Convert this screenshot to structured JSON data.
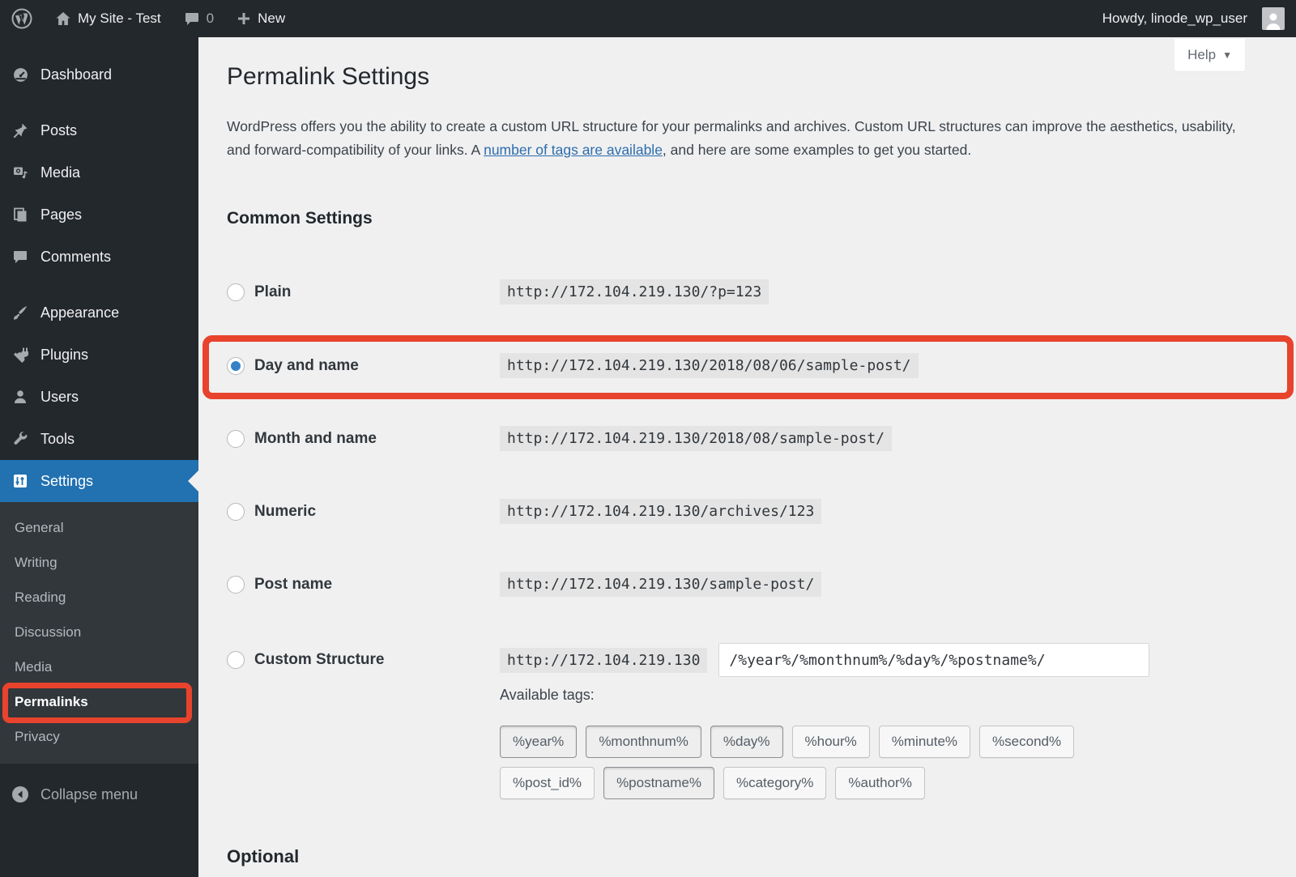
{
  "admin_bar": {
    "site_name": "My Site - Test",
    "comment_count": "0",
    "new_label": "New",
    "howdy": "Howdy, linode_wp_user"
  },
  "sidebar": {
    "items": [
      {
        "label": "Dashboard"
      },
      {
        "label": "Posts"
      },
      {
        "label": "Media"
      },
      {
        "label": "Pages"
      },
      {
        "label": "Comments"
      },
      {
        "label": "Appearance"
      },
      {
        "label": "Plugins"
      },
      {
        "label": "Users"
      },
      {
        "label": "Tools"
      },
      {
        "label": "Settings"
      }
    ],
    "settings_submenu": [
      {
        "label": "General"
      },
      {
        "label": "Writing"
      },
      {
        "label": "Reading"
      },
      {
        "label": "Discussion"
      },
      {
        "label": "Media"
      },
      {
        "label": "Permalinks"
      },
      {
        "label": "Privacy"
      }
    ],
    "collapse_label": "Collapse menu"
  },
  "main": {
    "help_label": "Help",
    "title": "Permalink Settings",
    "intro": {
      "before": "WordPress offers you the ability to create a custom URL structure for your permalinks and archives. Custom URL structures can improve the aesthetics, usability, and forward-compatibility of your links. A ",
      "link_text": "number of tags are available",
      "after": ", and here are some examples to get you started."
    },
    "common_settings_title": "Common Settings",
    "options": [
      {
        "label": "Plain",
        "value": "http://172.104.219.130/?p=123"
      },
      {
        "label": "Day and name",
        "value": "http://172.104.219.130/2018/08/06/sample-post/"
      },
      {
        "label": "Month and name",
        "value": "http://172.104.219.130/2018/08/sample-post/"
      },
      {
        "label": "Numeric",
        "value": "http://172.104.219.130/archives/123"
      },
      {
        "label": "Post name",
        "value": "http://172.104.219.130/sample-post/"
      }
    ],
    "custom": {
      "label": "Custom Structure",
      "base": "http://172.104.219.130",
      "input_value": "/%year%/%monthnum%/%day%/%postname%/"
    },
    "available_tags_label": "Available tags:",
    "tags_row1": [
      {
        "label": "%year%",
        "used": true
      },
      {
        "label": "%monthnum%",
        "used": true
      },
      {
        "label": "%day%",
        "used": true
      },
      {
        "label": "%hour%",
        "used": false
      },
      {
        "label": "%minute%",
        "used": false
      },
      {
        "label": "%second%",
        "used": false
      }
    ],
    "tags_row2": [
      {
        "label": "%post_id%",
        "used": false
      },
      {
        "label": "%postname%",
        "used": true
      },
      {
        "label": "%category%",
        "used": false
      },
      {
        "label": "%author%",
        "used": false
      }
    ],
    "optional_title": "Optional"
  },
  "colors": {
    "admin_bar_bg": "#23282d",
    "submenu_bg": "#32373c",
    "active_menu_bg": "#2271b1",
    "content_bg": "#f0f0f1",
    "annotation_red": "#e8432d",
    "link_blue": "#2c6dad",
    "radio_dot_blue": "#3582c4"
  }
}
